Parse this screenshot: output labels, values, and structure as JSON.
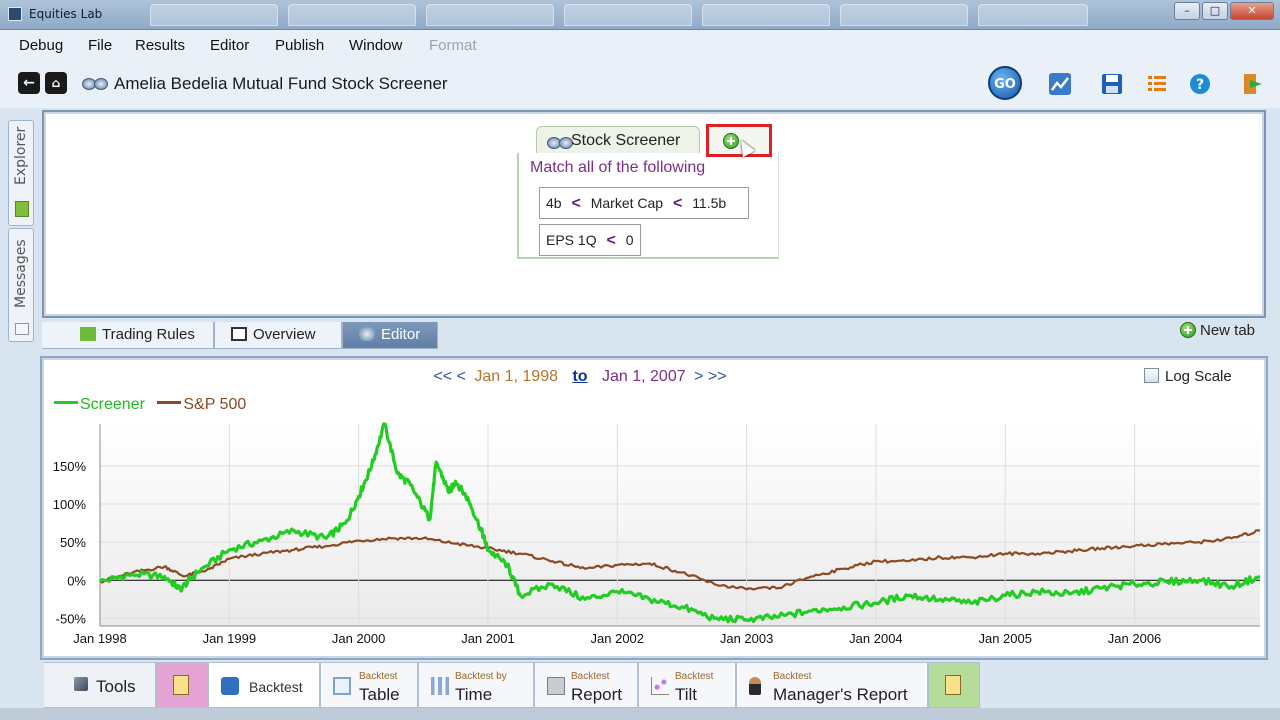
{
  "window": {
    "title": "Equities Lab"
  },
  "menu": [
    "Debug",
    "File",
    "Results",
    "Editor",
    "Publish",
    "Window",
    "Format"
  ],
  "toolbar": {
    "page_title": "Amelia Bedelia Mutual Fund Stock Screener",
    "go_label": "GO"
  },
  "side_tabs": [
    "Explorer",
    "Messages"
  ],
  "editor": {
    "tab_label": "Stock Screener",
    "match_label": "Match all of the following",
    "rule1": {
      "low": "4b",
      "op1": "<",
      "field": "Market Cap",
      "op2": "<",
      "high": "11.5b"
    },
    "rule2": {
      "field": "EPS 1Q",
      "op": "<",
      "value": "0"
    }
  },
  "lower_tabs": [
    "Trading Rules",
    "Overview",
    "Editor"
  ],
  "new_tab_label": "New tab",
  "chart_nav": {
    "back": "<< <",
    "from": "Jan 1, 1998",
    "to": "to",
    "until": "Jan 1, 2007",
    "forward": "> >>",
    "log_scale": "Log Scale"
  },
  "chart_data": {
    "type": "line",
    "title": "",
    "xlabel": "",
    "ylabel": "",
    "x_ticks": [
      "Jan 1998",
      "Jan 1999",
      "Jan 2000",
      "Jan 2001",
      "Jan 2002",
      "Jan 2003",
      "Jan 2004",
      "Jan 2005",
      "Jan 2006"
    ],
    "y_ticks": [
      "150%",
      "100%",
      "50%",
      "0%",
      "-50%"
    ],
    "ylim": [
      -60,
      205
    ],
    "xlim": [
      1998.0,
      2006.97
    ],
    "series": [
      {
        "name": "Screener",
        "color": "#22cc22",
        "x": [
          1998.0,
          1998.25,
          1998.5,
          1998.62,
          1998.75,
          1999.0,
          1999.25,
          1999.5,
          1999.75,
          1999.9,
          2000.0,
          2000.1,
          2000.2,
          2000.3,
          2000.4,
          2000.55,
          2000.6,
          2000.7,
          2000.75,
          2000.85,
          2000.95,
          2001.0,
          2001.15,
          2001.25,
          2001.5,
          2001.75,
          2002.0,
          2002.25,
          2002.5,
          2002.75,
          2003.0,
          2003.25,
          2003.5,
          2003.75,
          2004.0,
          2004.25,
          2004.5,
          2004.75,
          2005.0,
          2005.25,
          2005.5,
          2005.75,
          2006.0,
          2006.25,
          2006.5,
          2006.75,
          2006.97
        ],
        "y": [
          -2,
          8,
          5,
          -12,
          10,
          40,
          52,
          65,
          55,
          75,
          110,
          150,
          205,
          140,
          125,
          80,
          155,
          115,
          130,
          105,
          65,
          40,
          20,
          -20,
          -5,
          -25,
          -15,
          -25,
          -35,
          -50,
          -52,
          -48,
          -40,
          -35,
          -30,
          -20,
          -25,
          -30,
          -20,
          -15,
          -18,
          -10,
          -5,
          -2,
          0,
          -8,
          5
        ]
      },
      {
        "name": "S&P 500",
        "color": "#8b4a22",
        "x": [
          1998.0,
          1998.25,
          1998.5,
          1998.65,
          1998.85,
          1999.0,
          1999.25,
          1999.5,
          1999.75,
          2000.0,
          2000.25,
          2000.5,
          2000.75,
          2001.0,
          2001.25,
          2001.5,
          2001.75,
          2002.0,
          2002.25,
          2002.5,
          2002.75,
          2003.0,
          2003.25,
          2003.5,
          2003.75,
          2004.0,
          2004.25,
          2004.5,
          2004.75,
          2005.0,
          2005.25,
          2005.5,
          2005.75,
          2006.0,
          2006.25,
          2006.5,
          2006.75,
          2006.97
        ],
        "y": [
          -2,
          10,
          18,
          5,
          15,
          28,
          35,
          40,
          45,
          52,
          55,
          55,
          48,
          42,
          35,
          25,
          15,
          20,
          22,
          10,
          -5,
          -12,
          -10,
          5,
          15,
          25,
          25,
          30,
          30,
          35,
          35,
          38,
          42,
          45,
          48,
          50,
          55,
          65
        ]
      }
    ],
    "grid": true,
    "legend": "top-left",
    "log_scale": false
  },
  "bottom_tabs": [
    {
      "small": "",
      "big": "Tools"
    },
    {
      "small": "",
      "big": ""
    },
    {
      "small": "",
      "big": "Backtest"
    },
    {
      "small": "Backtest",
      "big": "Table"
    },
    {
      "small": "Backtest by",
      "big": "Time"
    },
    {
      "small": "Backtest",
      "big": "Report"
    },
    {
      "small": "Backtest",
      "big": "Tilt"
    },
    {
      "small": "Backtest",
      "big": "Manager's Report"
    },
    {
      "small": "",
      "big": ""
    }
  ]
}
